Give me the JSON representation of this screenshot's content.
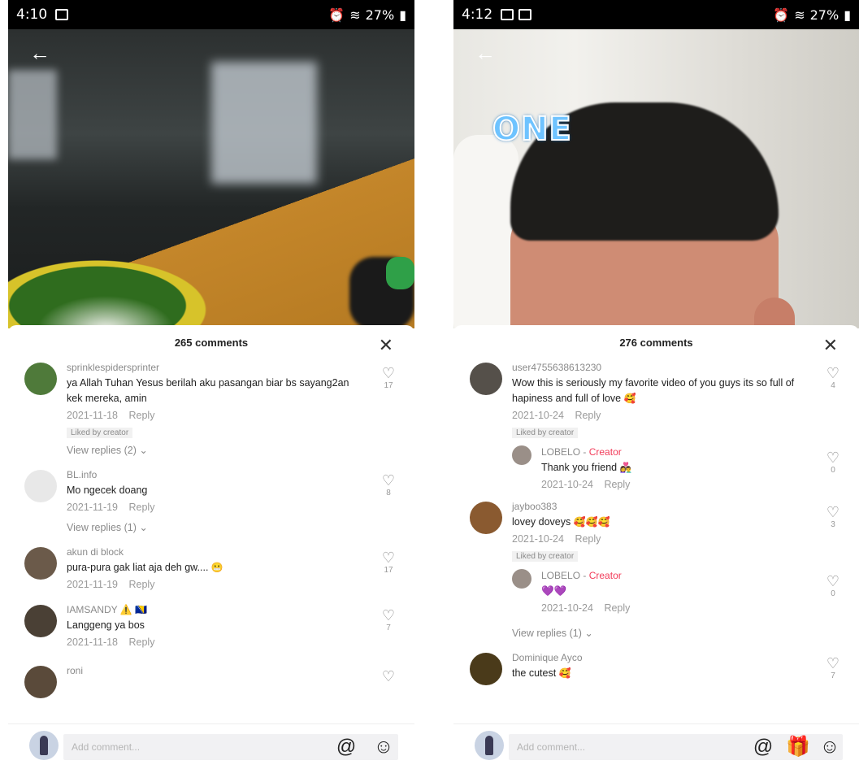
{
  "left": {
    "status": {
      "time": "4:10",
      "battery": "27%"
    },
    "sheet_title": "265 comments",
    "input_placeholder": "Add comment...",
    "comments": [
      {
        "user": "sprinklespidersprinter",
        "text": "ya Allah Tuhan Yesus berilah aku pasangan biar bs sayang2an kek mereka, amin",
        "date": "2021-11-18",
        "reply": "Reply",
        "liked": "Liked by creator",
        "view_replies": "View replies (2)",
        "likes": "17",
        "avatar_color": "#4f7a3a"
      },
      {
        "user": "BL.info",
        "text": "Mo ngecek doang",
        "date": "2021-11-19",
        "reply": "Reply",
        "view_replies": "View replies (1)",
        "likes": "8",
        "avatar_color": "#e8e8e8"
      },
      {
        "user": "akun di block",
        "text": "pura-pura gak liat aja deh gw....",
        "date": "2021-11-19",
        "reply": "Reply",
        "likes": "17",
        "avatar_color": "#6b5a4a"
      },
      {
        "user": "IAMSANDY",
        "text": "Langgeng ya bos",
        "date": "2021-11-18",
        "reply": "Reply",
        "likes": "7",
        "avatar_color": "#4a4035"
      },
      {
        "user": "roni",
        "text": "",
        "likes": "",
        "avatar_color": "#5a4a3a"
      }
    ]
  },
  "right": {
    "status": {
      "time": "4:12",
      "battery": "27%"
    },
    "video_text": "ONE",
    "sheet_title": "276 comments",
    "input_placeholder": "Add comment...",
    "comments": [
      {
        "user": "user4755638613230",
        "text": "Wow this is seriously my favorite video of you guys its so full of hapiness and full of love",
        "date": "2021-10-24",
        "reply": "Reply",
        "liked": "Liked by creator",
        "likes": "4",
        "avatar_color": "#55504a"
      },
      {
        "user": "LOBELO",
        "creator": "Creator",
        "text": "Thank you friend",
        "date": "2021-10-24",
        "reply": "Reply",
        "likes": "0",
        "is_reply": true,
        "avatar_color": "#9a8f88"
      },
      {
        "user": "jayboo383",
        "text": "lovey doveys",
        "date": "2021-10-24",
        "reply": "Reply",
        "liked": "Liked by creator",
        "likes": "3",
        "avatar_color": "#8a5a30"
      },
      {
        "user": "LOBELO",
        "creator": "Creator",
        "text": "💜💜",
        "date": "2021-10-24",
        "reply": "Reply",
        "likes": "0",
        "is_reply": true,
        "avatar_color": "#9a8f88"
      },
      {
        "view_replies": "View replies (1)"
      },
      {
        "user": "Dominique Ayco",
        "text": "the cutest",
        "likes": "7",
        "avatar_color": "#4a3a1a"
      }
    ]
  }
}
